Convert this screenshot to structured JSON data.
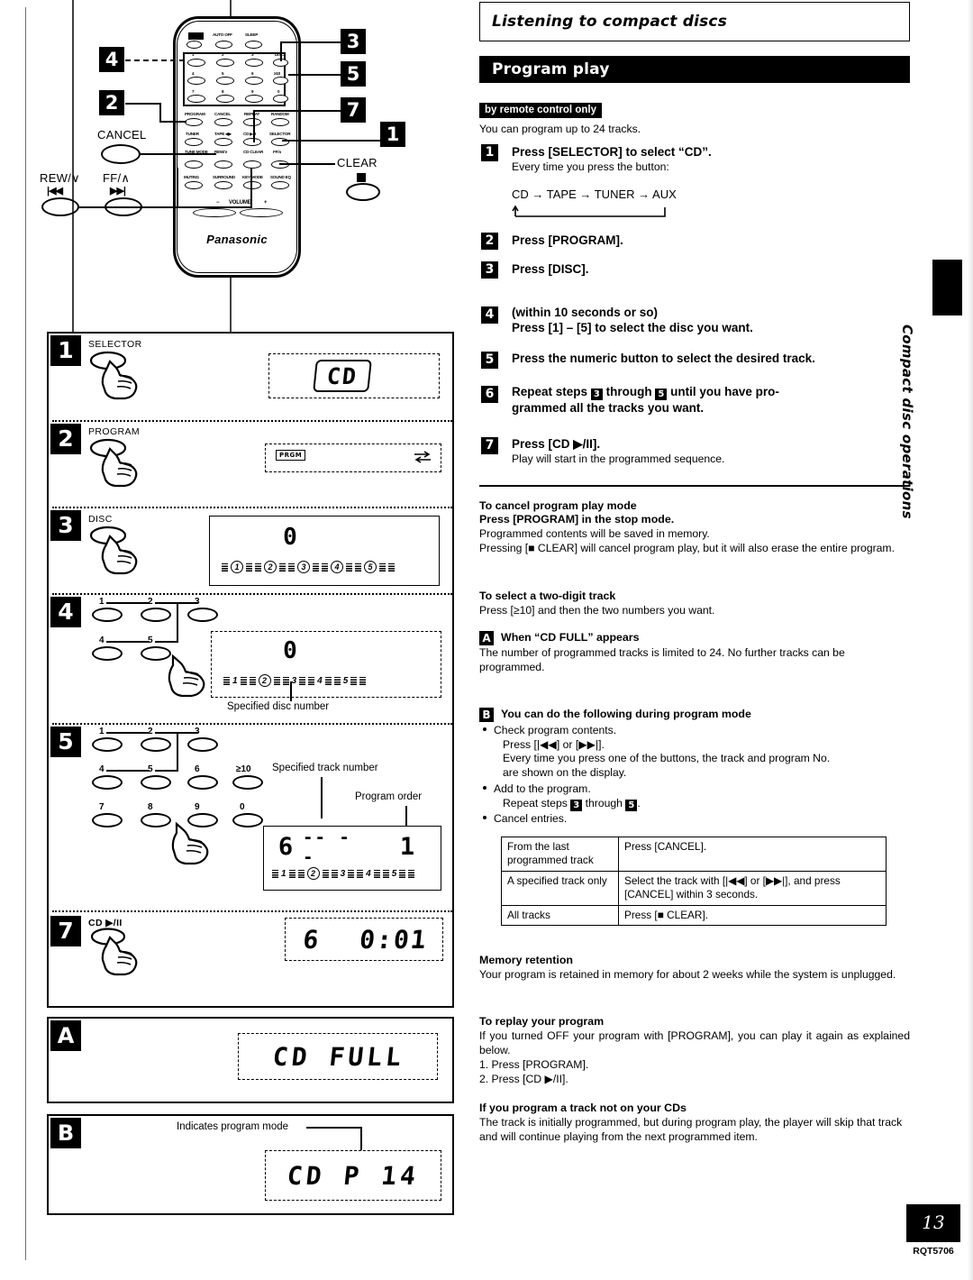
{
  "page": {
    "number": "13",
    "code": "RQT5706",
    "side_tab": "Compact disc operations"
  },
  "chapter": {
    "title": "Listening to compact discs"
  },
  "section": {
    "title": "Program play",
    "tag": "by remote control only",
    "intro": "You can program up to 24 tracks."
  },
  "steps": [
    {
      "num": "1",
      "head": "Press [SELECTOR] to select “CD”.",
      "sub": "Every time you press the button:",
      "cycle": "CD → TAPE → TUNER → AUX"
    },
    {
      "num": "2",
      "head": "Press [PROGRAM].",
      "sub": ""
    },
    {
      "num": "3",
      "head": "Press [DISC].",
      "sub": ""
    },
    {
      "num": "4",
      "head": "Press [1] – [5] to select the disc you want.",
      "sub": "(within 10 seconds or so)"
    },
    {
      "num": "5",
      "head": "Press the numeric button to select the desired track.",
      "sub": ""
    },
    {
      "num": "6",
      "head_a": "Repeat steps",
      "head_b": "through",
      "head_c": "until you have pro-",
      "head_d": "grammed all the tracks you want.",
      "ref1": "3",
      "ref2": "5"
    },
    {
      "num": "7",
      "head": "Press [CD ▶/II].",
      "sub": "Play will start in the programmed sequence."
    }
  ],
  "notes": {
    "cancel_title": "To cancel program play mode",
    "cancel_bold": "Press [PROGRAM] in the stop mode.",
    "cancel_l1": "Programmed contents will be saved in memory.",
    "cancel_l2": "Pressing [■ CLEAR] will cancel program play, but it will also erase the entire program.",
    "twodigit_title": "To select a two-digit track",
    "twodigit_body": "Press [≥10] and then the two numbers you want.",
    "a_badge": "A",
    "a_title": "When “CD FULL” appears",
    "a_body": "The number of programmed tracks is limited to 24. No further tracks can be programmed.",
    "b_badge": "B",
    "b_title": "You can do the following during program mode",
    "b_bullets": [
      {
        "l1": "Check program contents.",
        "l2": "Press [|◀◀] or [▶▶|].",
        "l3": "Every time you press one of the buttons, the track and program No.",
        "l4": "are shown on the display."
      },
      {
        "l1": "Add to the program.",
        "l2_a": "Repeat steps",
        "l2_ref1": "3",
        "l2_b": "through",
        "l2_ref2": "5",
        "l2_c": "."
      },
      {
        "l1": "Cancel entries."
      }
    ],
    "memory_title": "Memory retention",
    "memory_body": "Your program is retained in memory for about 2 weeks while the system is unplugged.",
    "replay_title": "To replay your program",
    "replay_body": "If you turned OFF your program with [PROGRAM], you can play it again as explained below.",
    "replay_1": "1.  Press [PROGRAM].",
    "replay_2": "2.  Press [CD ▶/II].",
    "notrack_title": "If you program a track not on your CDs",
    "notrack_body": "The track is initially programmed, but during program play, the player will skip that track and will continue playing from the next programmed item."
  },
  "cancel_table": {
    "rows": [
      {
        "left": "From the last programmed track",
        "right": "Press [CANCEL]."
      },
      {
        "left": "A specified track only",
        "right": "Select the track with [|◀◀] or [▶▶|], and press [CANCEL] within 3 seconds."
      },
      {
        "left": "All tracks",
        "right": "Press [■ CLEAR]."
      }
    ]
  },
  "remote": {
    "brand": "Panasonic",
    "row_top": [
      "⏻",
      "AUTO OFF",
      "SLEEP"
    ],
    "keys": [
      "1",
      "2",
      "3",
      "DISC",
      "4",
      "5",
      "6",
      "≥10",
      "7",
      "8",
      "9",
      "0"
    ],
    "row_fn1": [
      "PROGRAM",
      "CANCEL",
      "REPEAT",
      "RANDOM"
    ],
    "row_fn2": [
      "TUNER",
      "TAPE ◀▶",
      "CD ▶/II",
      "SELECTOR"
    ],
    "row_fn3": [
      "TUNE MODE",
      "REW/∨",
      "CD CLEAR",
      "FF/∧"
    ],
    "row_fn4": [
      "MUTING",
      "SURROUND",
      "KEY MODE",
      "SOUND EQ"
    ],
    "volume": {
      "minus": "−",
      "label": "VOLUME",
      "plus": "+"
    },
    "callouts": [
      "1",
      "2",
      "3",
      "4",
      "5",
      "7"
    ],
    "ext_labels": {
      "cancel": "CANCEL",
      "rew": "REW/∨",
      "ff": "FF/∧",
      "clear": "CLEAR",
      "rew_glyph": "|◀◀",
      "ff_glyph": "▶▶|"
    }
  },
  "diagram": {
    "steps": [
      {
        "num": "1",
        "label": "SELECTOR",
        "display": "CD"
      },
      {
        "num": "2",
        "label": "PROGRAM",
        "display": "PRGM"
      },
      {
        "num": "3",
        "label": "DISC",
        "display": "0",
        "discs": [
          "1",
          "2",
          "3",
          "4",
          "5"
        ]
      },
      {
        "num": "4",
        "label": "",
        "display": "0",
        "discs": [
          "1",
          "2",
          "3",
          "4",
          "5"
        ],
        "caption": "Specified disc number",
        "keys": [
          "1",
          "2",
          "3",
          "4",
          "5"
        ]
      },
      {
        "num": "5",
        "label": "",
        "display_track": "6",
        "display_dashes": "-- --",
        "display_order": "1",
        "caption_track": "Specified track number",
        "caption_order": "Program order",
        "keys": [
          "1",
          "2",
          "3",
          "4",
          "5",
          "6",
          "≥10",
          "7",
          "8",
          "9",
          "0"
        ],
        "discs": [
          "1",
          "2",
          "3",
          "4",
          "5"
        ]
      },
      {
        "num": "7",
        "label": "CD ▶/II",
        "display_track": "6",
        "display_time": "0:01"
      }
    ],
    "panel_a": {
      "badge": "A",
      "display": "CD FULL"
    },
    "panel_b": {
      "badge": "B",
      "caption": "Indicates program mode",
      "display": "CD  P 14"
    }
  }
}
